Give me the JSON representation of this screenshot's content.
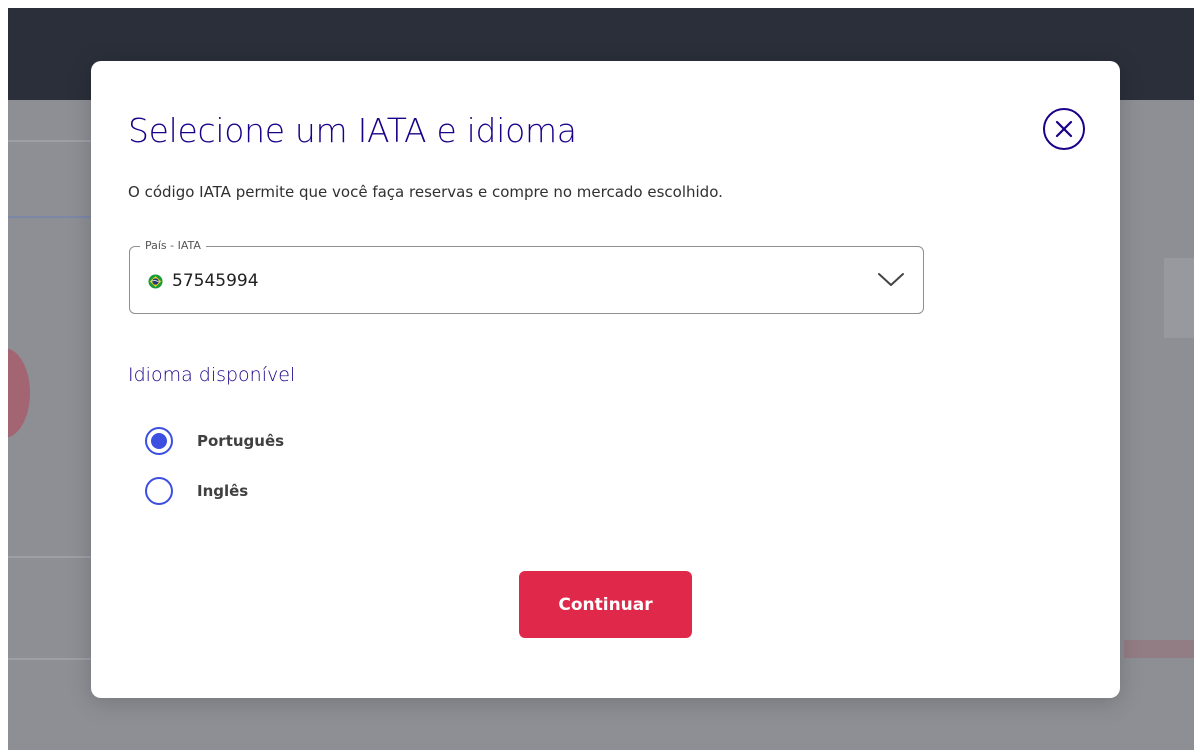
{
  "modal": {
    "title": "Selecione um IATA e idioma",
    "description": "O código IATA permite que você faça reservas e compre no mercado escolhido.",
    "close_icon": "close-icon",
    "iata_field": {
      "label": "País - IATA",
      "value": "57545994",
      "flag_icon": "brazil-flag-icon",
      "dropdown_icon": "chevron-down-icon"
    },
    "language": {
      "heading": "Idioma disponível",
      "options": [
        {
          "label": "Português",
          "selected": true
        },
        {
          "label": "Inglês",
          "selected": false
        }
      ]
    },
    "continue_label": "Continuar"
  },
  "colors": {
    "brand_primary": "#1b0088",
    "radio_accent": "#3c4fe0",
    "button_red": "#e0294a",
    "backdrop": "#8d8f94",
    "backdrop_header": "#2a2f3a"
  }
}
